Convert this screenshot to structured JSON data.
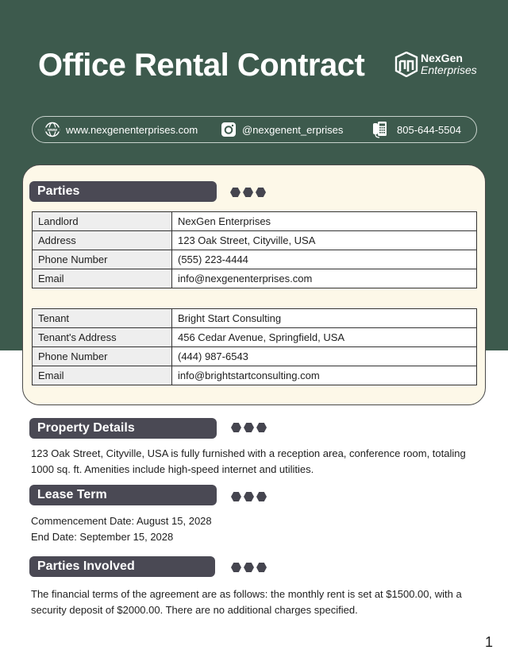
{
  "header": {
    "title": "Office Rental Contract",
    "logo": {
      "name": "NexGen",
      "subtitle": "Enterprises",
      "icon": "building-cube-icon"
    }
  },
  "contact": {
    "website": {
      "icon": "globe-www-icon",
      "text": "www.nexgenenterprises.com"
    },
    "social": {
      "icon": "instagram-icon",
      "text": "@nexgenent_erprises"
    },
    "phone": {
      "icon": "telephone-icon",
      "text": "805-644-5504"
    }
  },
  "sections": {
    "parties": {
      "title": "Parties",
      "landlord_table": [
        {
          "label": "Landlord",
          "value": "NexGen Enterprises"
        },
        {
          "label": "Address",
          "value": "123 Oak Street, Cityville, USA"
        },
        {
          "label": "Phone Number",
          "value": "(555) 223-4444"
        },
        {
          "label": "Email",
          "value": "info@nexgenenterprises.com"
        }
      ],
      "tenant_table": [
        {
          "label": "Tenant",
          "value": "Bright Start Consulting"
        },
        {
          "label": "Tenant's Address",
          "value": "456 Cedar Avenue, Springfield, USA"
        },
        {
          "label": "Phone Number",
          "value": "(444) 987-6543"
        },
        {
          "label": "Email",
          "value": "info@brightstartconsulting.com"
        }
      ]
    },
    "property_details": {
      "title": "Property Details",
      "text": "123 Oak Street, Cityville, USA is fully furnished with a reception area, conference room, totaling 1000 sq. ft. Amenities include high-speed internet and utilities."
    },
    "lease_term": {
      "title": "Lease Term",
      "lines": [
        "Commencement Date: August 15, 2028",
        "End Date: September 15, 2028"
      ]
    },
    "parties_involved": {
      "title": "Parties Involved",
      "text": "The financial terms of the agreement are as follows: the monthly rent is set at $1500.00, with a security deposit of $2000.00. There are no additional charges specified."
    }
  },
  "footer": {
    "page_number": "1"
  },
  "colors": {
    "header_green": "#3d5a4d",
    "card_cream": "#fdf8e8",
    "section_head": "#4a4954",
    "text": "#1e1e1e"
  }
}
